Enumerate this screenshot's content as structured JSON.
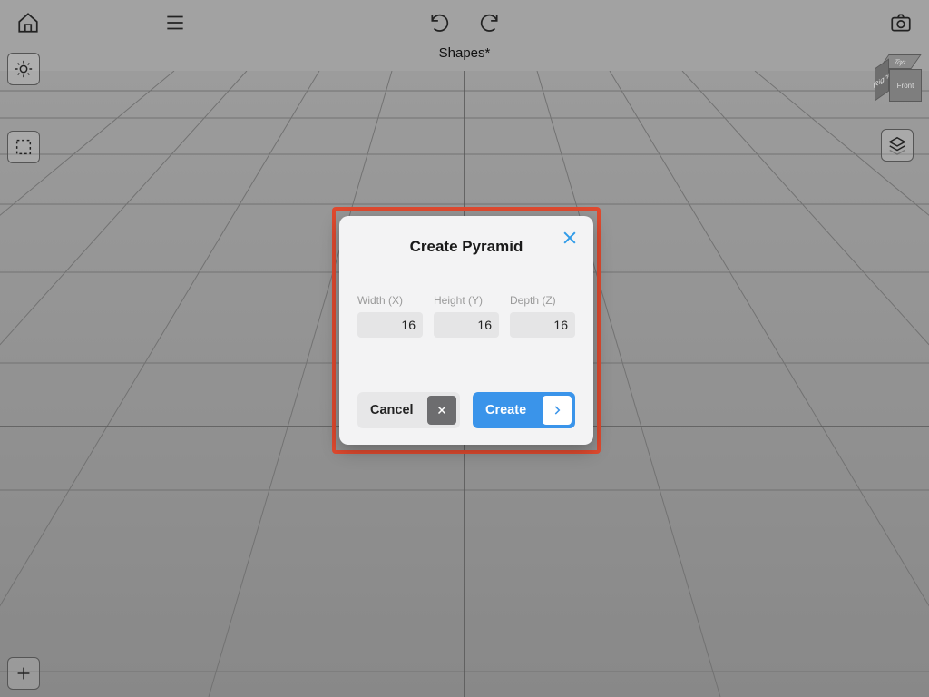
{
  "document_title": "Shapes*",
  "view_cube": {
    "top": "Top",
    "front": "Front",
    "side": "Right"
  },
  "dialog": {
    "title": "Create Pyramid",
    "fields": {
      "width": {
        "label": "Width (X)",
        "value": "16"
      },
      "height": {
        "label": "Height (Y)",
        "value": "16"
      },
      "depth": {
        "label": "Depth (Z)",
        "value": "16"
      }
    },
    "cancel_label": "Cancel",
    "create_label": "Create"
  }
}
